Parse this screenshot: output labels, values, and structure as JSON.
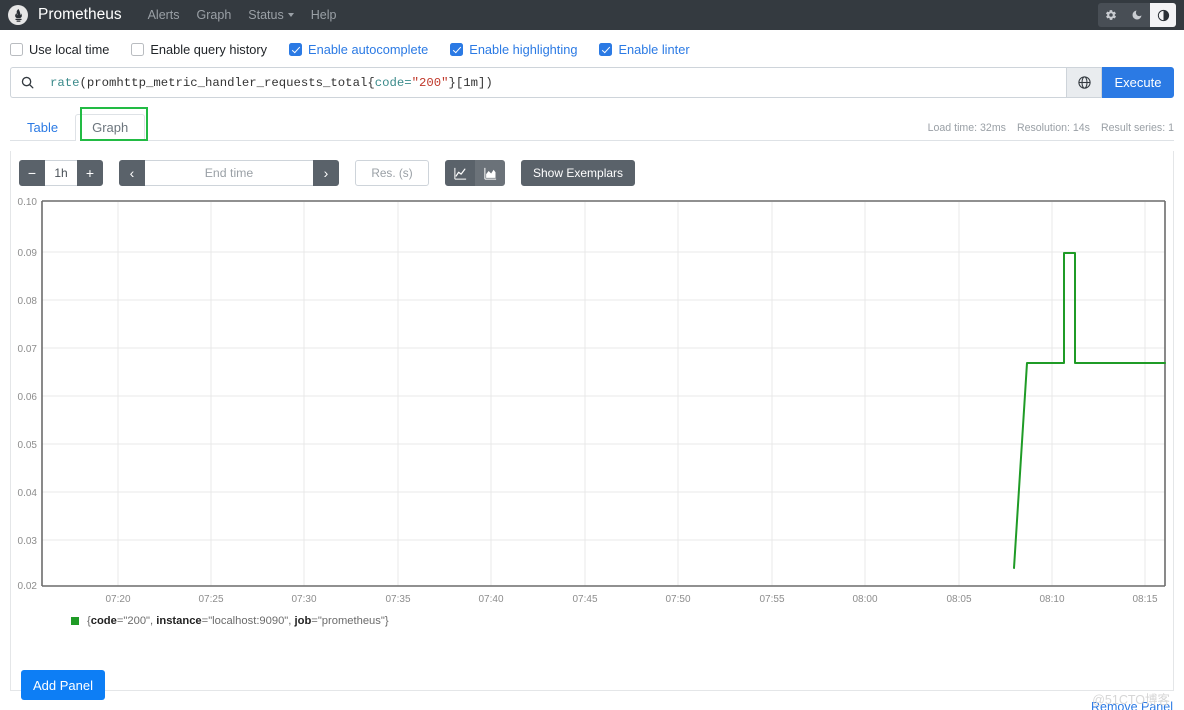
{
  "navbar": {
    "brand": "Prometheus",
    "logo_icon": "prometheus-torch-icon",
    "links": [
      {
        "label": "Alerts",
        "has_caret": false
      },
      {
        "label": "Graph",
        "has_caret": false
      },
      {
        "label": "Status",
        "has_caret": true
      },
      {
        "label": "Help",
        "has_caret": false
      }
    ],
    "theme_buttons": [
      {
        "icon": "gear-icon",
        "active": false
      },
      {
        "icon": "moon-icon",
        "active": false
      },
      {
        "icon": "contrast-half-circle-icon",
        "active": true
      }
    ]
  },
  "options": [
    {
      "label": "Use local time",
      "checked": false
    },
    {
      "label": "Enable query history",
      "checked": false
    },
    {
      "label": "Enable autocomplete",
      "checked": true
    },
    {
      "label": "Enable highlighting",
      "checked": true
    },
    {
      "label": "Enable linter",
      "checked": true
    }
  ],
  "query": {
    "search_icon": "search-icon",
    "expression": "rate(promhttp_metric_handler_requests_total{code=\"200\"}[1m])",
    "tokens": [
      {
        "text": "rate",
        "kind": "fn"
      },
      {
        "text": "(promhttp_metric_handler_requests_total{",
        "kind": "plain"
      },
      {
        "text": "code=",
        "kind": "label"
      },
      {
        "text": "\"200\"",
        "kind": "str"
      },
      {
        "text": "}[1m])",
        "kind": "plain"
      }
    ],
    "globe_icon": "globe-icon",
    "execute_label": "Execute"
  },
  "tabs": [
    {
      "label": "Table",
      "active": false
    },
    {
      "label": "Graph",
      "active": true
    }
  ],
  "stats": {
    "load_time": "Load time: 32ms",
    "resolution": "Resolution: 14s",
    "result_series": "Result series: 1"
  },
  "controls": {
    "decrease_label": "−",
    "range_value": "1h",
    "increase_label": "+",
    "prev_label": "‹",
    "end_time_placeholder": "End time",
    "next_label": "›",
    "resolution_placeholder": "Res. (s)",
    "line_chart_icon": "line-chart-icon",
    "stacked_chart_icon": "stacked-area-chart-icon",
    "show_exemplars_label": "Show Exemplars"
  },
  "legend": {
    "series_color": "#1f9b26",
    "parts": [
      {
        "text": "{",
        "bold": false
      },
      {
        "text": "code",
        "bold": true
      },
      {
        "text": "=",
        "bold": false
      },
      {
        "text": "\"200\"",
        "bold": false
      },
      {
        "text": ", ",
        "bold": false
      },
      {
        "text": "instance",
        "bold": true
      },
      {
        "text": "=",
        "bold": false
      },
      {
        "text": "\"localhost:9090\"",
        "bold": false
      },
      {
        "text": ", ",
        "bold": false
      },
      {
        "text": "job",
        "bold": true
      },
      {
        "text": "=",
        "bold": false
      },
      {
        "text": "\"prometheus\"",
        "bold": false
      },
      {
        "text": "}",
        "bold": false
      }
    ],
    "full_text": "{code=\"200\", instance=\"localhost:9090\", job=\"prometheus\"}"
  },
  "footer": {
    "remove_panel_label": "Remove Panel",
    "add_panel_label": "Add Panel"
  },
  "watermark": "@51CTO博客",
  "chart_data": {
    "type": "line",
    "title": "",
    "xlabel": "",
    "ylabel": "",
    "ylim": [
      0.02,
      0.1
    ],
    "yticks": [
      0.02,
      0.03,
      0.04,
      0.05,
      0.06,
      0.07,
      0.08,
      0.09,
      0.1
    ],
    "ytick_labels": [
      "0.02",
      "0.03",
      "0.04",
      "0.05",
      "0.06",
      "0.07",
      "0.08",
      "0.09",
      "0.10"
    ],
    "xticks": [
      "07:20",
      "07:25",
      "07:30",
      "07:35",
      "07:40",
      "07:45",
      "07:50",
      "07:55",
      "08:00",
      "08:05",
      "08:10",
      "08:15"
    ],
    "xlim": [
      "07:17",
      "08:17"
    ],
    "grid": true,
    "legend_position": "bottom-left",
    "series": [
      {
        "name": "{code=\"200\", instance=\"localhost:9090\", job=\"prometheus\"}",
        "color": "#1f9b26",
        "x": [
          "08:07",
          "08:08",
          "08:08.5",
          "08:10",
          "08:10.2",
          "08:10.8",
          "08:11",
          "08:17"
        ],
        "values": [
          0.0232,
          0.0667,
          0.0667,
          0.0667,
          0.0897,
          0.0897,
          0.0667,
          0.0667
        ]
      }
    ]
  }
}
